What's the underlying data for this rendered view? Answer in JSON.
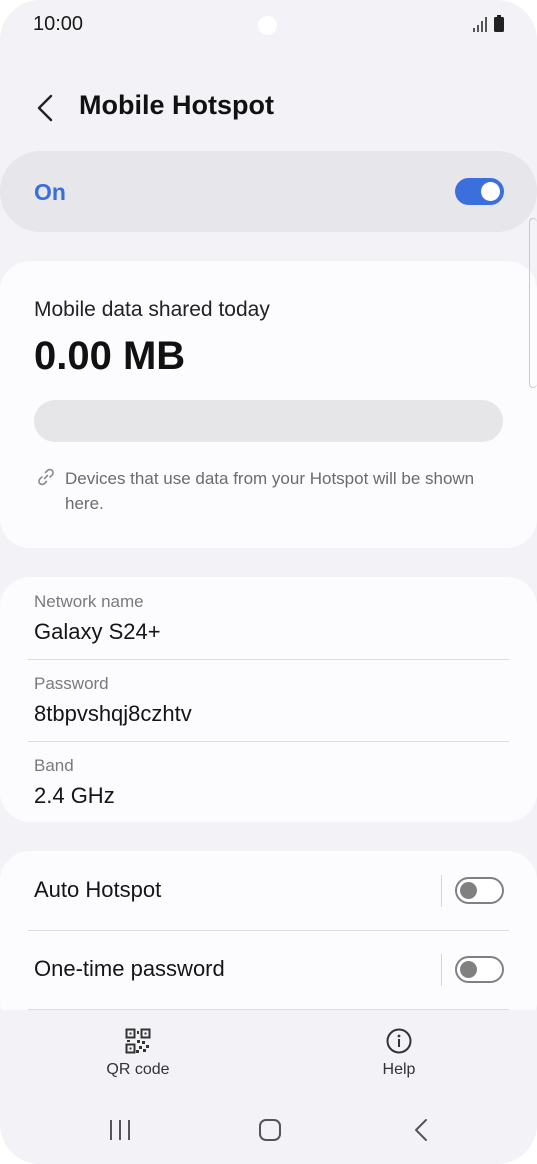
{
  "status_bar": {
    "time": "10:00",
    "icons": [
      "signal-icon",
      "battery-icon"
    ]
  },
  "header": {
    "title": "Mobile Hotspot",
    "back_icon": "chevron-left-icon"
  },
  "master_switch": {
    "label": "On",
    "state": "on"
  },
  "data_usage": {
    "title": "Mobile data shared today",
    "value": "0.00 MB",
    "fill_fraction": 0,
    "note": "Devices that use data from your Hotspot will be shown here.",
    "note_icon": "link-icon"
  },
  "network": {
    "rows": [
      {
        "label": "Network name",
        "value": "Galaxy S24+"
      },
      {
        "label": "Password",
        "value": "8tbpvshqj8czhtv"
      },
      {
        "label": "Band",
        "value": "2.4 GHz"
      }
    ]
  },
  "settings": {
    "rows": [
      {
        "label": "Auto Hotspot",
        "state": "off"
      },
      {
        "label": "One-time password",
        "state": "off"
      }
    ]
  },
  "bottom_actions": [
    {
      "label": "QR code",
      "icon": "qr-code-icon"
    },
    {
      "label": "Help",
      "icon": "help-icon"
    }
  ],
  "nav_bar": [
    "recent-apps-icon",
    "home-icon",
    "back-icon"
  ],
  "colors": {
    "accent": "#3b70dc",
    "background": "#f3f3f7",
    "card": "#fcfcfe"
  }
}
